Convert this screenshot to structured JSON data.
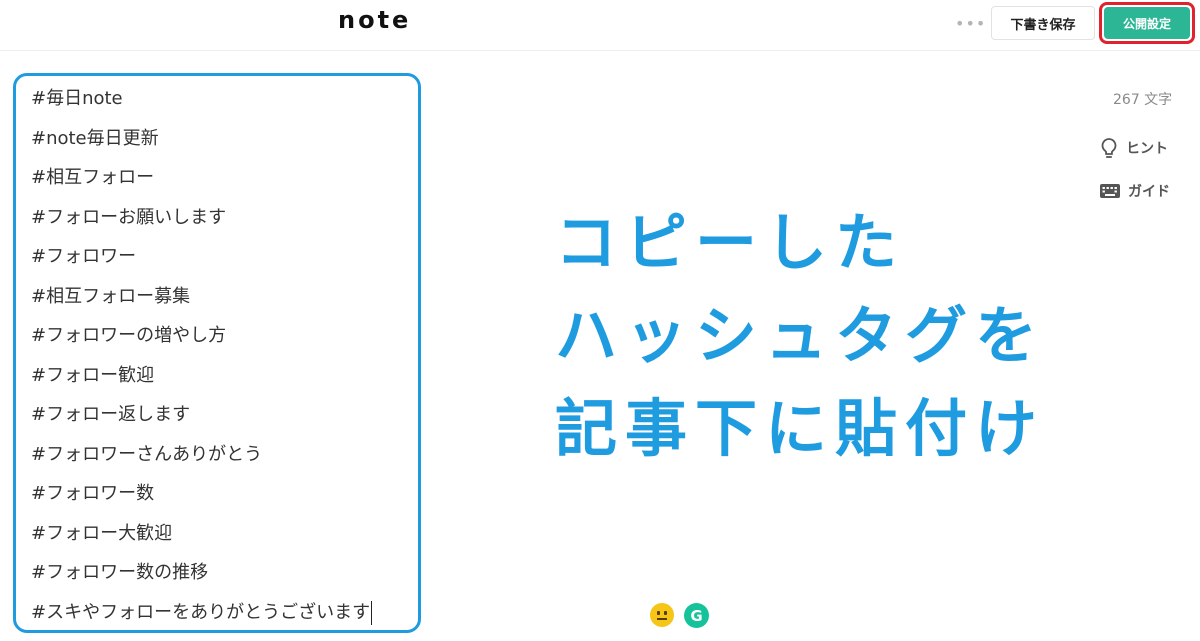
{
  "header": {
    "logo": "note",
    "more_label": "•••",
    "draft_save_label": "下書き保存",
    "publish_settings_label": "公開設定"
  },
  "editor": {
    "hashtags": [
      "#毎日note",
      "#note毎日更新",
      "#相互フォロー",
      "#フォローお願いします",
      "#フォロワー",
      "#相互フォロー募集",
      "#フォロワーの増やし方",
      "#フォロー歓迎",
      "#フォロー返します",
      "#フォロワーさんありがとう",
      "#フォロワー数",
      "#フォロー大歓迎",
      "#フォロワー数の推移",
      "#スキやフォローをありがとうございます"
    ]
  },
  "sidebar": {
    "char_count": "267 文字",
    "hint_label": "ヒント",
    "guide_label": "ガイド"
  },
  "overlay": {
    "lines": [
      "コピーした",
      "ハッシュタグを",
      "記事下に貼付け"
    ],
    "color": "#1f9be0"
  },
  "footer_icons": [
    "neutral-face-emoji-icon",
    "grammarly-icon"
  ],
  "colors": {
    "publish_button": "#2cb696",
    "highlight_outline": "#e0222e",
    "editor_outline": "#1f9be0"
  }
}
